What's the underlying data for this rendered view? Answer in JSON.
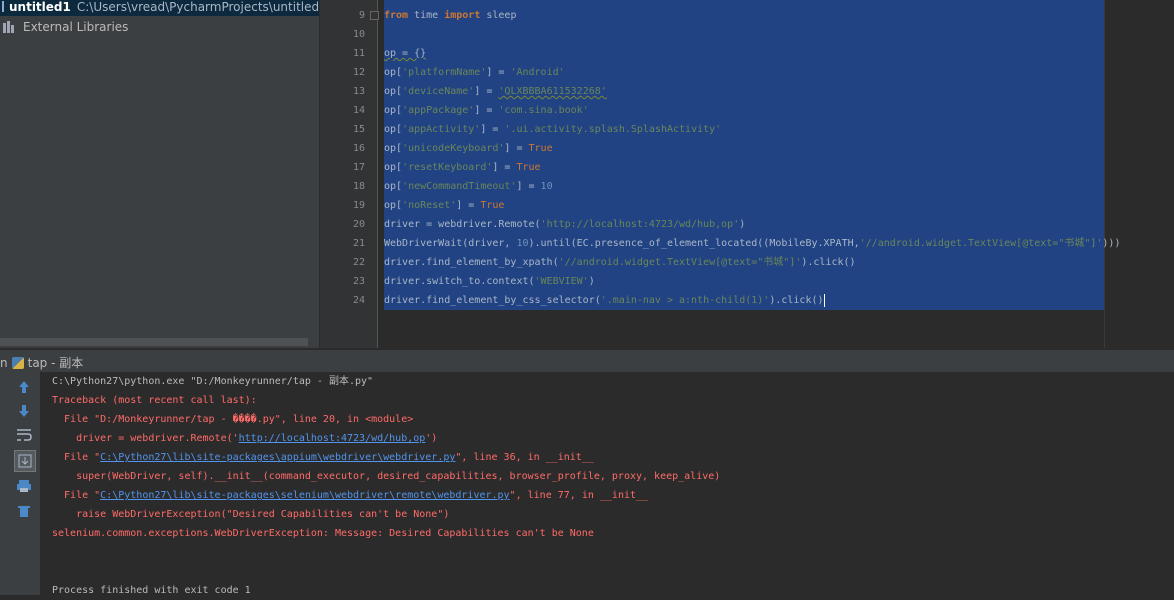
{
  "project": {
    "root_name": "untitled1",
    "root_path": "C:\\Users\\vread\\PycharmProjects\\untitled",
    "external_libraries": "External Libraries"
  },
  "editor": {
    "line_numbers": [
      "9",
      "10",
      "11",
      "12",
      "13",
      "14",
      "15",
      "16",
      "17",
      "18",
      "19",
      "20",
      "21",
      "22",
      "23",
      "24"
    ],
    "line9": {
      "from": "from",
      "mod": " time ",
      "import": "import",
      "name": " sleep"
    },
    "line11": "op = {}",
    "line12": {
      "a": "op[",
      "k": "'platformName'",
      "b": "] = ",
      "v": "'Android'"
    },
    "line13": {
      "a": "op[",
      "k": "'deviceName'",
      "b": "] = ",
      "v": "'QLXBBBA611532268'"
    },
    "line14": {
      "a": "op[",
      "k": "'appPackage'",
      "b": "] = ",
      "v": "'com.sina.book'"
    },
    "line15": {
      "a": "op[",
      "k": "'appActivity'",
      "b": "] = ",
      "v": "'.ui.activity.splash.SplashActivity'"
    },
    "line16": {
      "a": "op[",
      "k": "'unicodeKeyboard'",
      "b": "] = ",
      "v": "True"
    },
    "line17": {
      "a": "op[",
      "k": "'resetKeyboard'",
      "b": "] = ",
      "v": "True"
    },
    "line18": {
      "a": "op[",
      "k": "'newCommandTimeout'",
      "b": "] = ",
      "v": "10"
    },
    "line19": {
      "a": "op[",
      "k": "'noReset'",
      "b": "] = ",
      "v": "True"
    },
    "line20": {
      "a": "driver = webdriver.Remote(",
      "s": "'http://localhost:4723/wd/hub,op'",
      "b": ")"
    },
    "line21": {
      "a": "WebDriverWait(driver, ",
      "n": "10",
      "b": ").until(EC.presence_of_element_located((MobileBy.XPATH,",
      "s": "'//android.widget.TextView[@text=\"书城\"]'",
      "c": ")))"
    },
    "line22": {
      "a": "driver.find_element_by_xpath(",
      "s": "'//android.widget.TextView[@text=\"书城\"]'",
      "b": ").click()"
    },
    "line23": {
      "a": "driver.switch_to.context(",
      "s": "'WEBVIEW'",
      "b": ")"
    },
    "line24": {
      "a": "driver.find_element_by_css_selector(",
      "s": "'.main-nav > a:nth-child(1)'",
      "b": ").click()"
    }
  },
  "run": {
    "tab_prefix": "n",
    "title": "tap - 副本",
    "console": {
      "cmd": "C:\\Python27\\python.exe \"D:/Monkeyrunner/tap - 副本.py\"",
      "traceback": "Traceback (most recent call last):",
      "f1_pre": "  File \"D:/Monkeyrunner/tap - ����.py\", line 20, in <module>",
      "f1_code_pre": "    driver = webdriver.Remote('",
      "f1_code_link": "http://localhost:4723/wd/hub,op",
      "f1_code_post": "')",
      "f2_pre": "  File \"",
      "f2_link": "C:\\Python27\\lib\\site-packages\\appium\\webdriver\\webdriver.py",
      "f2_post": "\", line 36, in __init__",
      "f2_code": "    super(WebDriver, self).__init__(command_executor, desired_capabilities, browser_profile, proxy, keep_alive)",
      "f3_pre": "  File \"",
      "f3_link": "C:\\Python27\\lib\\site-packages\\selenium\\webdriver\\remote\\webdriver.py",
      "f3_post": "\", line 77, in __init__",
      "f3_code": "    raise WebDriverException(\"Desired Capabilities can't be None\")",
      "exception": "selenium.common.exceptions.WebDriverException: Message: Desired Capabilities can't be None",
      "exit": "Process finished with exit code 1"
    },
    "toolbar_icons": [
      "up-arrow-icon",
      "down-arrow-icon",
      "soft-wrap-icon",
      "scroll-to-end-icon",
      "print-icon",
      "trash-icon"
    ]
  }
}
